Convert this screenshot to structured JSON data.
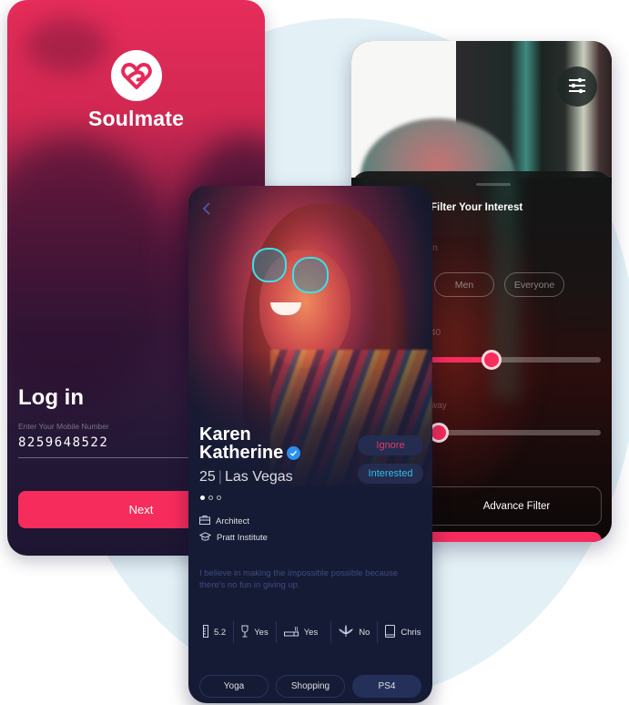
{
  "colors": {
    "accent": "#f52c5c",
    "profile_bg": "#161b35",
    "verified": "#2b8ff0",
    "ignore": "#e43864",
    "interested": "#33bfe0",
    "bg_blob": "#e3f1f7"
  },
  "login": {
    "brand": "Soulmate",
    "logo_icon": "heart-infinity-logo",
    "title": "Log in",
    "mobile_label": "Enter Your Mobile Number",
    "mobile_value": "8259648522",
    "next_label": "Next"
  },
  "filter": {
    "filter_icon": "sliders-icon",
    "title": "Filter Your Interest",
    "show_me_label_partial": "in",
    "gender_options": [
      "Men",
      "Everyone"
    ],
    "age_label_partial": "40",
    "distance_label_partial": "way",
    "age_slider_value_percent": 38,
    "distance_slider_value_percent": 8,
    "advance_filter_label": "Advance Filter"
  },
  "profile": {
    "back_icon": "chevron-left-icon",
    "first_name": "Karen",
    "last_name": "Katherine",
    "verified_icon": "verified-check-icon",
    "age": "25",
    "city": "Las Vegas",
    "photo_count": 3,
    "active_photo": 1,
    "ignore_label": "Ignore",
    "interested_label": "Interested",
    "occupation": "Architect",
    "education": "Pratt Institute",
    "bio": "I believe in making the impossible possible because there's no fun in giving up.",
    "stats": [
      {
        "icon": "ruler-icon",
        "value": "5.2"
      },
      {
        "icon": "wine-glass-icon",
        "value": "Yes"
      },
      {
        "icon": "cigarette-icon",
        "value": "Yes"
      },
      {
        "icon": "cannabis-leaf-icon",
        "value": "No"
      },
      {
        "icon": "book-icon",
        "value": "Chris"
      }
    ],
    "interests": [
      {
        "label": "Yoga",
        "active": false
      },
      {
        "label": "Shopping",
        "active": false
      },
      {
        "label": "PS4",
        "active": true
      }
    ]
  }
}
